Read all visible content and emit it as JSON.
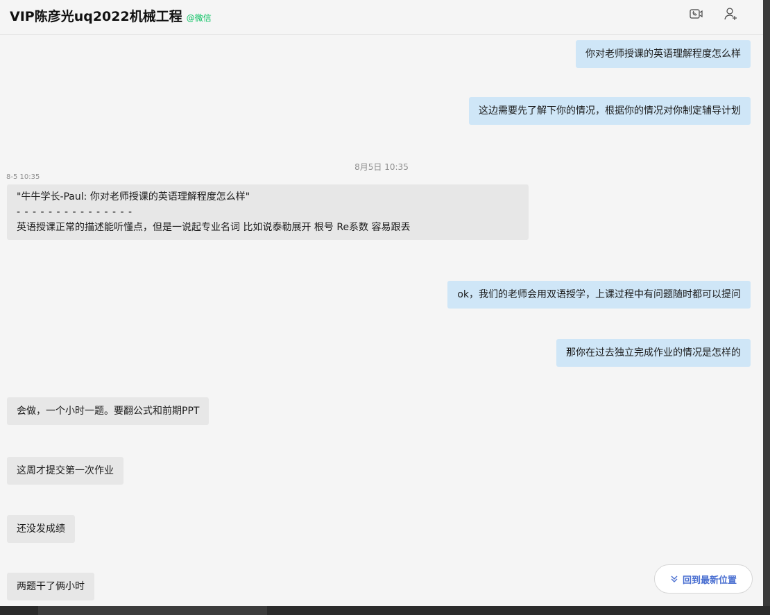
{
  "header": {
    "title": "VIP陈彦光uq2022机械工程",
    "tag": "@微信"
  },
  "system_time": "8月5日 10:35",
  "messages": [
    {
      "direction": "out",
      "text": "你对老师授课的英语理解程度怎么样"
    },
    {
      "direction": "out",
      "text": "这边需要先了解下你的情况，根据你的情况对你制定辅导计划"
    },
    {
      "direction": "in",
      "time": "8-5 10:35",
      "quote": "\"牛牛学长-Paul: 你对老师授课的英语理解程度怎么样\"",
      "divider": "- - - - - - - - - - - - - - -",
      "text": "英语授课正常的描述能听懂点，但是一说起专业名词 比如说泰勒展开 根号 Re系数 容易跟丢"
    },
    {
      "direction": "out",
      "text": "ok，我们的老师会用双语授学，上课过程中有问题随时都可以提问"
    },
    {
      "direction": "out",
      "text": "那你在过去独立完成作业的情况是怎样的"
    },
    {
      "direction": "in",
      "text": "会做，一个小时一题。要翻公式和前期PPT"
    },
    {
      "direction": "in",
      "text": "这周才提交第一次作业"
    },
    {
      "direction": "in",
      "text": "还没发成绩"
    },
    {
      "direction": "in",
      "text": "两题干了俩小时"
    }
  ],
  "latest_button": {
    "label": "回到最新位置"
  },
  "icons": {
    "call": "video-call-icon",
    "add_member": "add-member-icon",
    "chevrons": "double-chevron-down-icon"
  },
  "colors": {
    "outgoing_bubble": "#cfe6f7",
    "incoming_bubble": "#e7e7e7",
    "accent_green": "#07c160",
    "link_blue": "#4a6fd1"
  }
}
